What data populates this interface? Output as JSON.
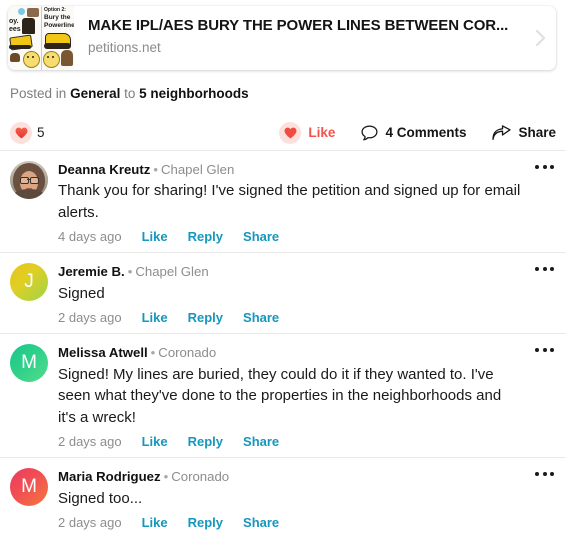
{
  "link_card": {
    "title": "MAKE IPL/AES BURY THE POWER LINES BETWEEN COR...",
    "host": "petitions.net",
    "thumbnail_alt": "petition flyer cartoon with excavators",
    "thumb_text_left": "oy. ees",
    "thumb_text_right_line1": "Option 2:",
    "thumb_text_right_line2": "Bury the",
    "thumb_text_right_line3": "Powerline",
    "chevron_icon": "chevron-right-icon"
  },
  "posted": {
    "prefix": "Posted in",
    "category": "General",
    "middle": "to",
    "audience": "5 neighborhoods"
  },
  "actions": {
    "reaction_count": "5",
    "reaction_icon": "heart-icon",
    "like_label": "Like",
    "like_icon": "heart-icon",
    "comments_label": "4 Comments",
    "comments_icon": "comment-bubble-icon",
    "share_label": "Share",
    "share_icon": "share-arrow-icon",
    "like_color": "#f0544c",
    "link_color": "#1697bd"
  },
  "comments": [
    {
      "name": "Deanna Kreutz",
      "separator": "•",
      "neighborhood": "Chapel Glen",
      "text": "Thank you for sharing!  I've signed the petition and signed up for email alerts.",
      "time": "4 days ago",
      "like": "Like",
      "reply": "Reply",
      "share": "Share",
      "avatar_type": "photo",
      "avatar_initial": ""
    },
    {
      "name": "Jeremie B.",
      "separator": "•",
      "neighborhood": "Chapel Glen",
      "text": "Signed",
      "time": "2 days ago",
      "like": "Like",
      "reply": "Reply",
      "share": "Share",
      "avatar_type": "g-yellow",
      "avatar_initial": "J"
    },
    {
      "name": "Melissa Atwell",
      "separator": "•",
      "neighborhood": "Coronado",
      "text": "Signed!  My lines are buried, they could do it if they wanted to. I've seen what they've done to the properties in the neighborhoods and it's a wreck!",
      "time": "2 days ago",
      "like": "Like",
      "reply": "Reply",
      "share": "Share",
      "avatar_type": "g-green",
      "avatar_initial": "M"
    },
    {
      "name": "Maria Rodriguez",
      "separator": "•",
      "neighborhood": "Coronado",
      "text": "Signed too...",
      "time": "2 days ago",
      "like": "Like",
      "reply": "Reply",
      "share": "Share",
      "avatar_type": "g-red",
      "avatar_initial": "M"
    }
  ],
  "menu": {
    "overflow_icon": "more-options-icon"
  }
}
